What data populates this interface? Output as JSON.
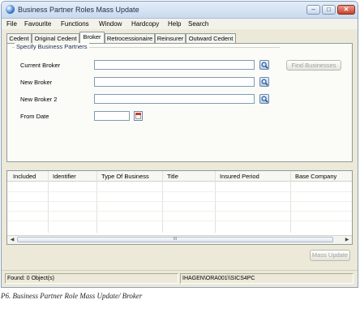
{
  "window": {
    "title": "Business Partner Roles Mass Update",
    "controls": {
      "minimize": "–",
      "maximize": "□",
      "close": "✕"
    }
  },
  "menubar": [
    "File",
    "Favourite",
    "Functions",
    "Window",
    "Hardcopy",
    "Help",
    "Search"
  ],
  "tabs": [
    {
      "label": "Cedent",
      "active": false
    },
    {
      "label": "Original Cedent",
      "active": false
    },
    {
      "label": "Broker",
      "active": true
    },
    {
      "label": "Retrocessionaire",
      "active": false
    },
    {
      "label": "Reinsurer",
      "active": false
    },
    {
      "label": "Outward Cedent",
      "active": false
    }
  ],
  "group": {
    "title": "Specify Business Partners",
    "fields": [
      {
        "label": "Current Broker",
        "value": ""
      },
      {
        "label": "New Broker",
        "value": ""
      },
      {
        "label": "New Broker 2",
        "value": ""
      },
      {
        "label": "From Date",
        "value": ""
      }
    ],
    "find_button": "Find Businesses"
  },
  "grid": {
    "columns": [
      "Included",
      "Identifier",
      "Type Of Business",
      "Title",
      "Insured Period",
      "Base Company"
    ],
    "rows": [],
    "scroll_thumb": "III"
  },
  "actions": {
    "mass_update": "Mass Update"
  },
  "status": {
    "found": "Found: 0 Object(s)",
    "session": "IHAGEN\\ORA001\\\\SICS4PC"
  },
  "caption": "P6. Business Partner Role Mass Update/ Broker",
  "icons": {
    "lookup": "magnifier-icon",
    "calendar": "calendar-icon",
    "app": "globe-icon"
  }
}
